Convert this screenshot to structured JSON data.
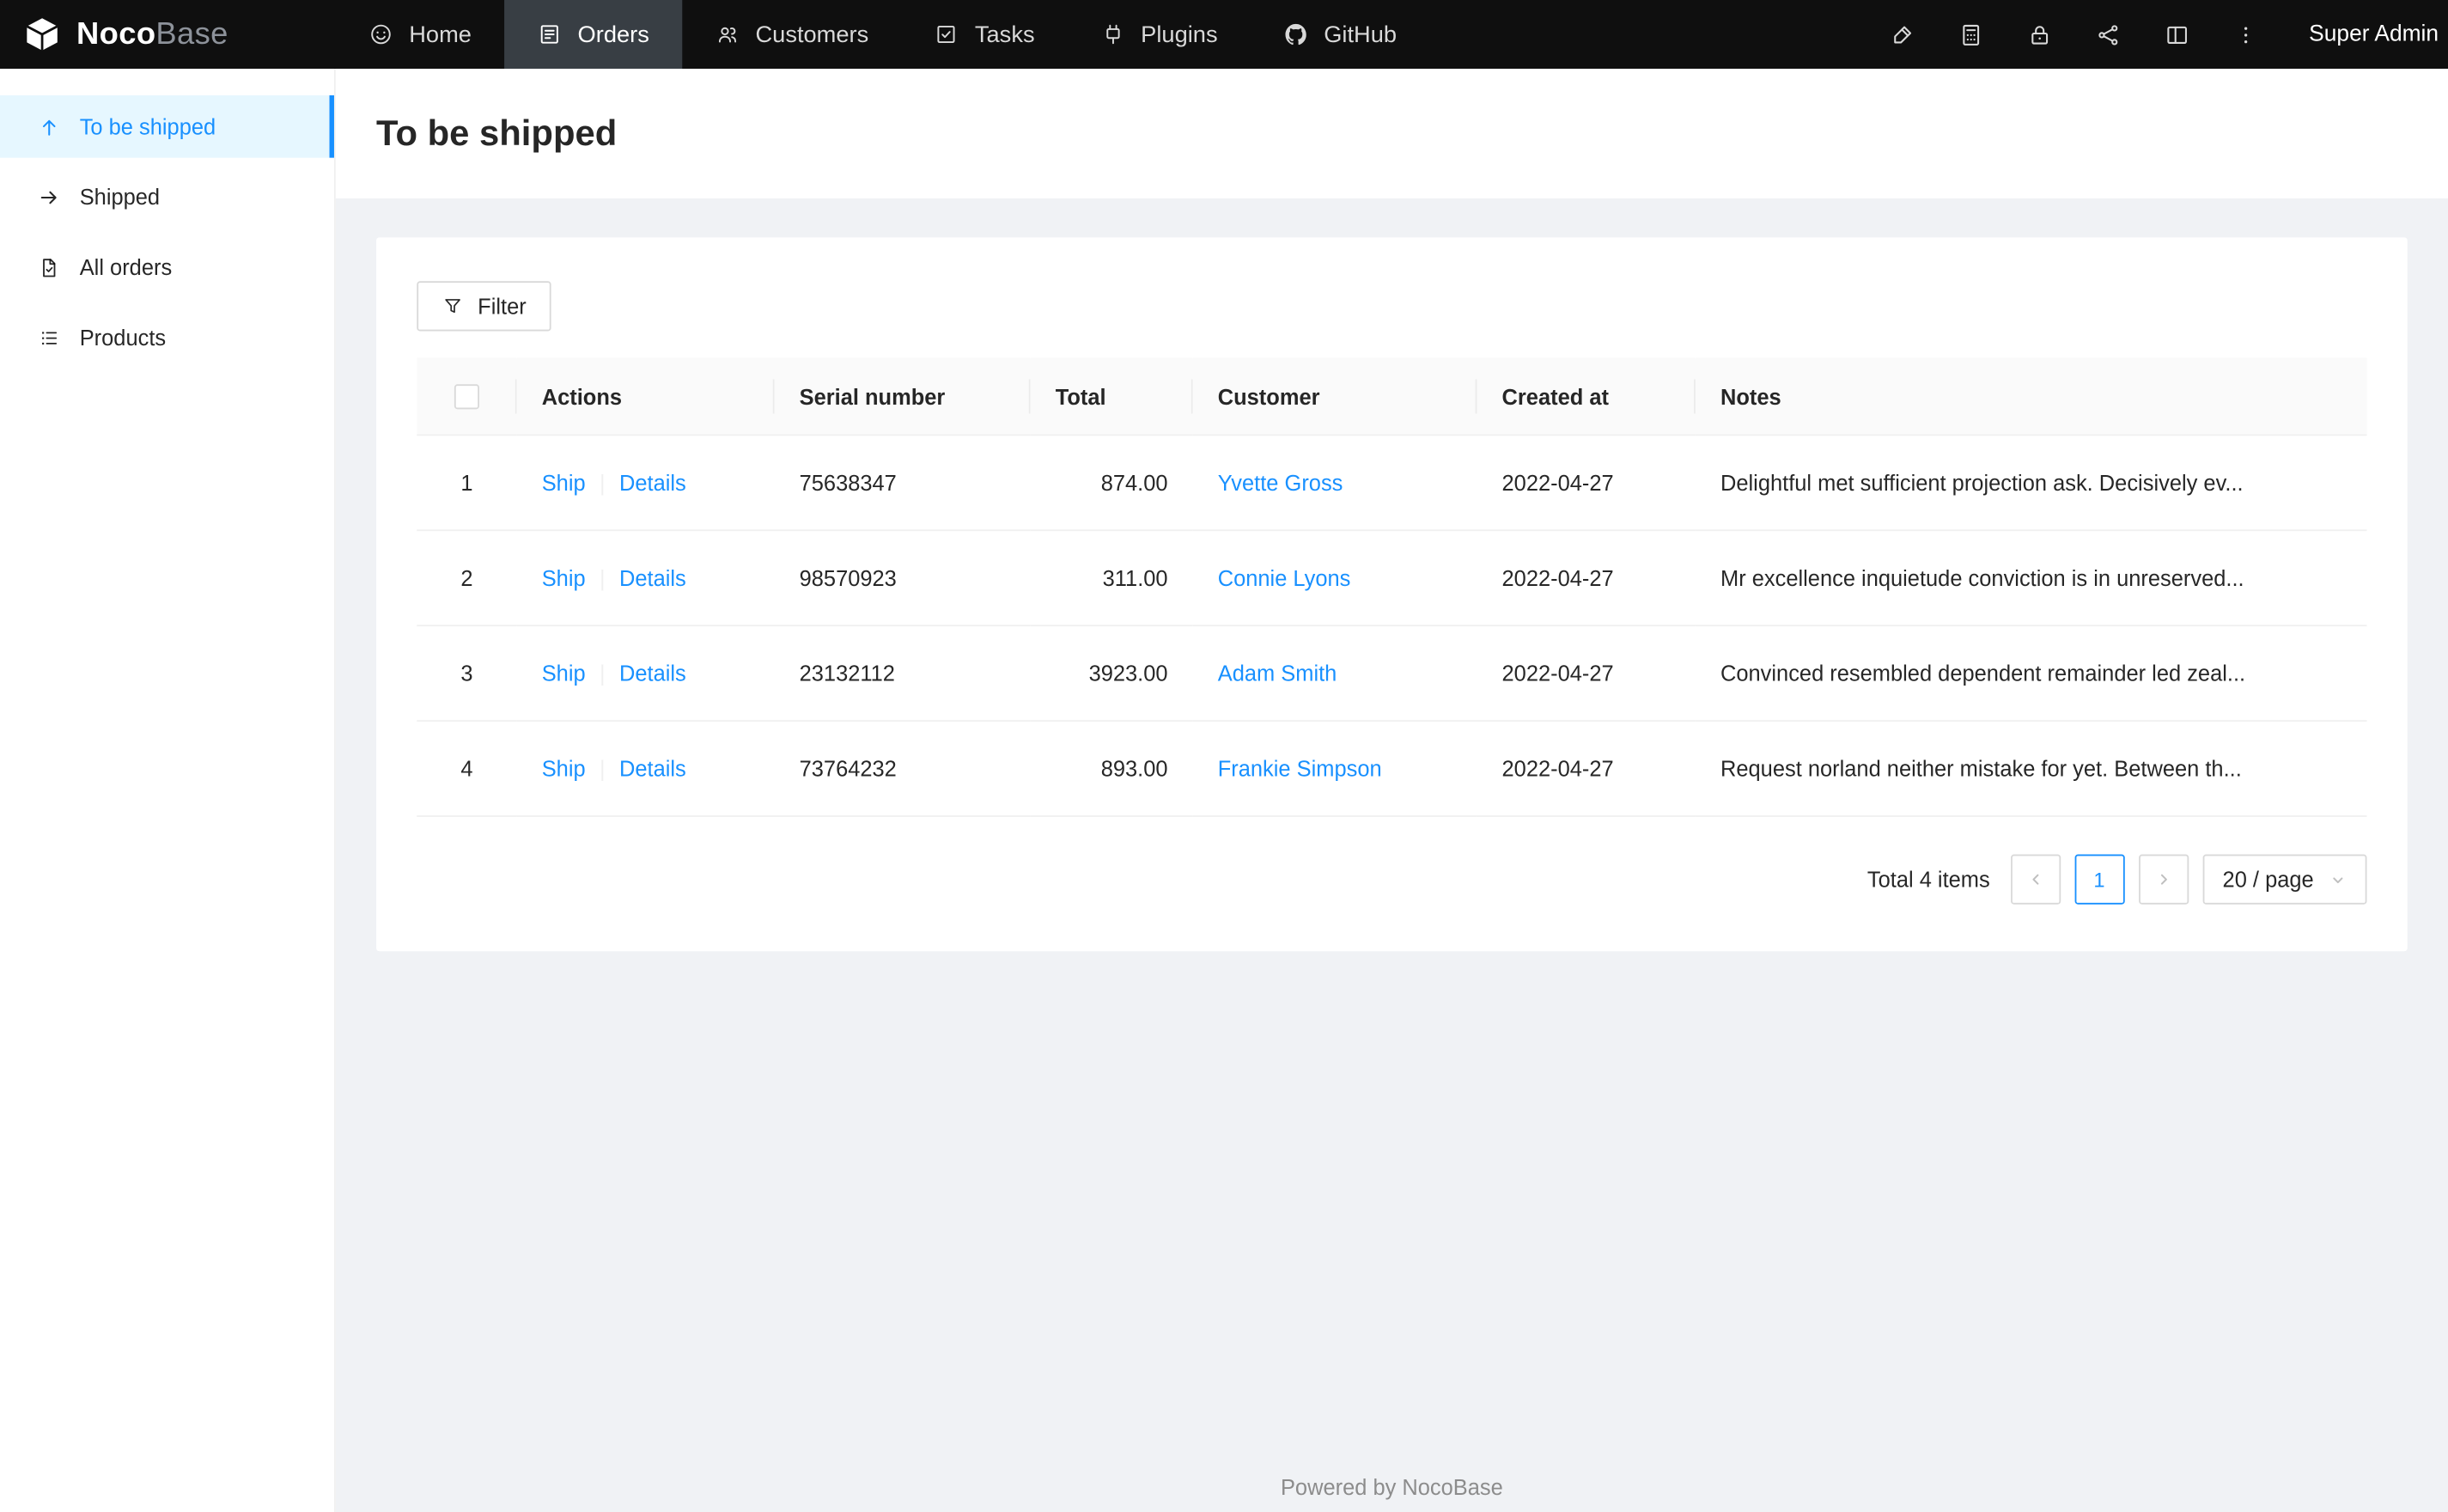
{
  "app": {
    "brand": {
      "name_bold": "Noco",
      "name_light": "Base"
    },
    "user": "Super Admin"
  },
  "navbar": {
    "items": [
      {
        "label": "Home",
        "icon": "smile-icon",
        "active": false
      },
      {
        "label": "Orders",
        "icon": "orders-icon",
        "active": true
      },
      {
        "label": "Customers",
        "icon": "customers-icon",
        "active": false
      },
      {
        "label": "Tasks",
        "icon": "tasks-icon",
        "active": false
      },
      {
        "label": "Plugins",
        "icon": "plugin-icon",
        "active": false
      },
      {
        "label": "GitHub",
        "icon": "github-icon",
        "active": false
      }
    ],
    "action_icons": [
      "highlighter-icon",
      "calculator-icon",
      "lock-icon",
      "share-icon",
      "layout-icon",
      "more-icon"
    ]
  },
  "sidebar": {
    "items": [
      {
        "label": "To be shipped",
        "icon": "arrow-up-icon",
        "active": true
      },
      {
        "label": "Shipped",
        "icon": "arrow-right-icon",
        "active": false
      },
      {
        "label": "All orders",
        "icon": "file-check-icon",
        "active": false
      },
      {
        "label": "Products",
        "icon": "list-icon",
        "active": false
      }
    ]
  },
  "page": {
    "title": "To be shipped"
  },
  "toolbar": {
    "filter_label": "Filter"
  },
  "table": {
    "columns": [
      "Actions",
      "Serial number",
      "Total",
      "Customer",
      "Created at",
      "Notes"
    ],
    "action_labels": {
      "ship": "Ship",
      "details": "Details"
    },
    "rows": [
      {
        "index": "1",
        "serial": "75638347",
        "total": "874.00",
        "customer": "Yvette Gross",
        "created_at": "2022-04-27",
        "notes": "Delightful met sufficient projection ask. Decisively ev..."
      },
      {
        "index": "2",
        "serial": "98570923",
        "total": "311.00",
        "customer": "Connie Lyons",
        "created_at": "2022-04-27",
        "notes": "Mr excellence inquietude conviction is in unreserved..."
      },
      {
        "index": "3",
        "serial": "23132112",
        "total": "3923.00",
        "customer": "Adam Smith",
        "created_at": "2022-04-27",
        "notes": "Convinced resembled dependent remainder led zeal..."
      },
      {
        "index": "4",
        "serial": "73764232",
        "total": "893.00",
        "customer": "Frankie Simpson",
        "created_at": "2022-04-27",
        "notes": "Request norland neither mistake for yet. Between th..."
      }
    ]
  },
  "pagination": {
    "total_text": "Total 4 items",
    "current_page": "1",
    "page_size": "20 / page"
  },
  "footer": {
    "text": "Powered by NocoBase"
  },
  "colors": {
    "accent": "#1890ff",
    "active_item_bg": "#e6f7ff",
    "navbar_bg": "#0f0f0f",
    "navbar_active_bg": "#383e44",
    "content_bg": "#f0f2f5"
  }
}
